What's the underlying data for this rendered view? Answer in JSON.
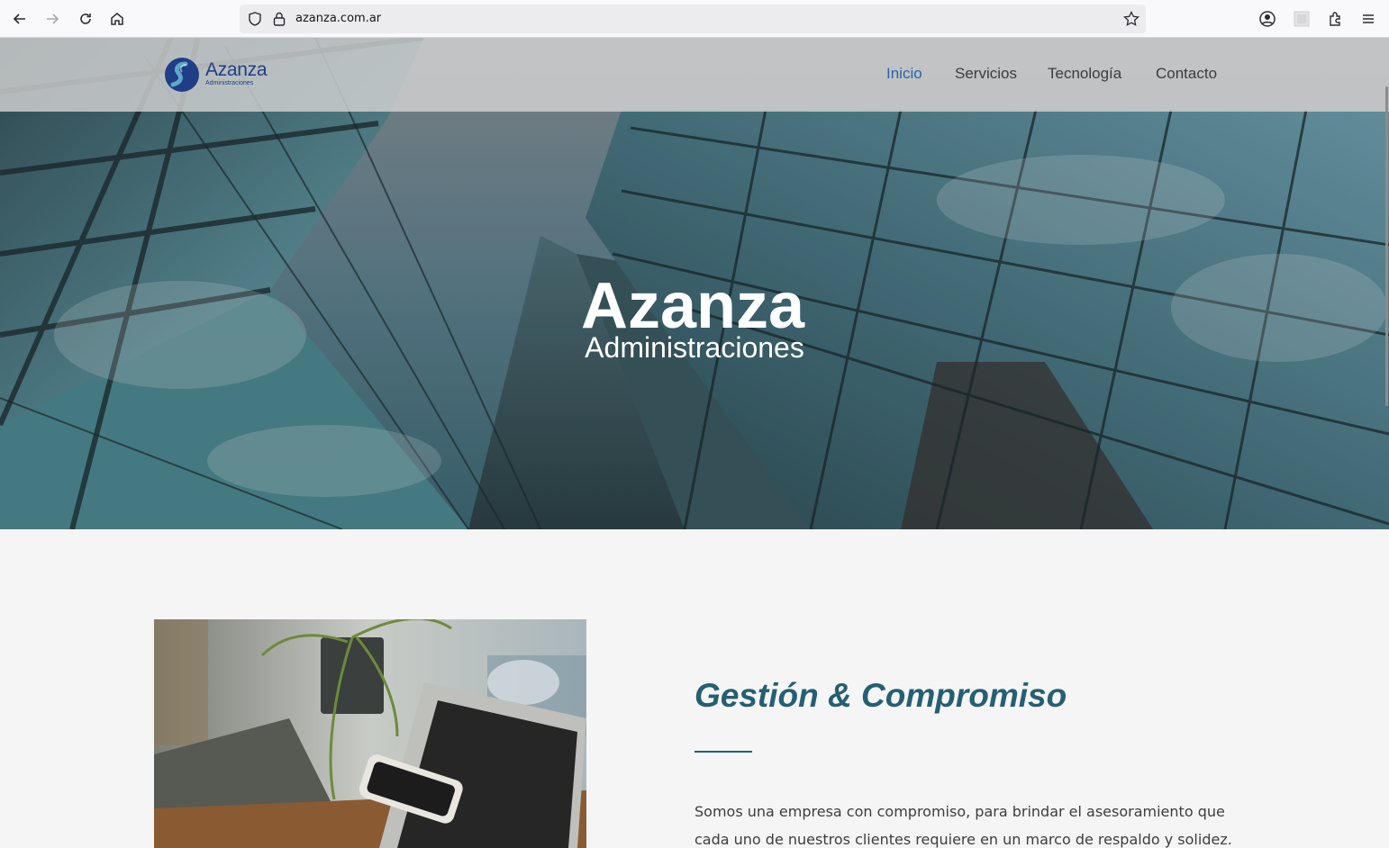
{
  "browser": {
    "url": "azanza.com.ar"
  },
  "header": {
    "logo_name": "Azanza",
    "logo_sub": "Administraciones",
    "nav": [
      {
        "label": "Inicio",
        "active": true
      },
      {
        "label": "Servicios",
        "active": false
      },
      {
        "label": "Tecnología",
        "active": false
      },
      {
        "label": "Contacto",
        "active": false
      }
    ]
  },
  "hero": {
    "title": "Azanza",
    "subtitle": "Administraciones"
  },
  "about": {
    "title": "Gestión & Compromiso",
    "text": "Somos una empresa con compromiso, para brindar el asesoramiento que cada uno de nuestros clientes requiere en un marco de respaldo y solidez."
  },
  "colors": {
    "accent": "#255f72",
    "nav_active": "#2a64a8",
    "brand": "#1f3e86"
  }
}
